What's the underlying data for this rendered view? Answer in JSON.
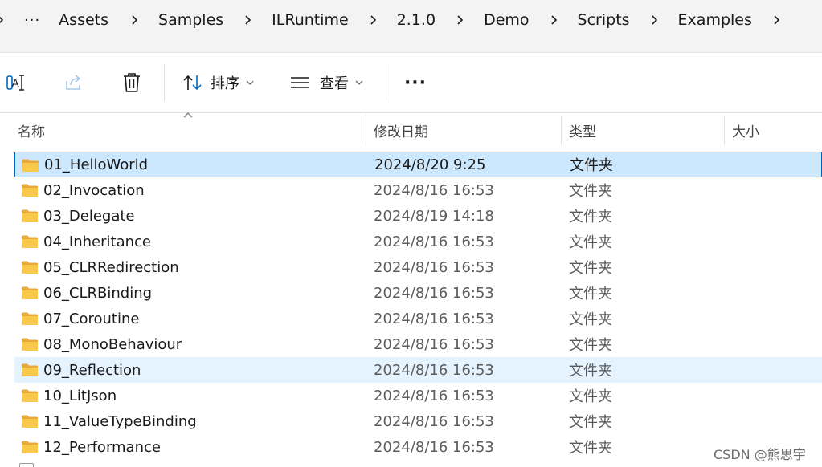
{
  "breadcrumb": {
    "overflow": "···",
    "items": [
      "Assets",
      "Samples",
      "ILRuntime",
      "2.1.0",
      "Demo",
      "Scripts",
      "Examples"
    ]
  },
  "toolbar": {
    "sort_label": "排序",
    "view_label": "查看",
    "more_label": "···"
  },
  "columns": {
    "name": "名称",
    "modified": "修改日期",
    "type": "类型",
    "size": "大小"
  },
  "rows": [
    {
      "name": "01_HelloWorld",
      "date": "2024/8/20 9:25",
      "type": "文件夹",
      "state": "selected"
    },
    {
      "name": "02_Invocation",
      "date": "2024/8/16 16:53",
      "type": "文件夹",
      "state": ""
    },
    {
      "name": "03_Delegate",
      "date": "2024/8/19 14:18",
      "type": "文件夹",
      "state": ""
    },
    {
      "name": "04_Inheritance",
      "date": "2024/8/16 16:53",
      "type": "文件夹",
      "state": ""
    },
    {
      "name": "05_CLRRedirection",
      "date": "2024/8/16 16:53",
      "type": "文件夹",
      "state": ""
    },
    {
      "name": "06_CLRBinding",
      "date": "2024/8/16 16:53",
      "type": "文件夹",
      "state": ""
    },
    {
      "name": "07_Coroutine",
      "date": "2024/8/16 16:53",
      "type": "文件夹",
      "state": ""
    },
    {
      "name": "08_MonoBehaviour",
      "date": "2024/8/16 16:53",
      "type": "文件夹",
      "state": ""
    },
    {
      "name": "09_Reflection",
      "date": "2024/8/16 16:53",
      "type": "文件夹",
      "state": "hover"
    },
    {
      "name": "10_LitJson",
      "date": "2024/8/16 16:53",
      "type": "文件夹",
      "state": ""
    },
    {
      "name": "11_ValueTypeBinding",
      "date": "2024/8/16 16:53",
      "type": "文件夹",
      "state": ""
    },
    {
      "name": "12_Performance",
      "date": "2024/8/16 16:53",
      "type": "文件夹",
      "state": ""
    }
  ],
  "colors": {
    "selected_bg": "#cce8ff",
    "selected_border": "#0067c0",
    "hover_bg": "#e5f3ff",
    "folder_yellow": "#f8c94a"
  },
  "watermark": "CSDN @熊思宇"
}
